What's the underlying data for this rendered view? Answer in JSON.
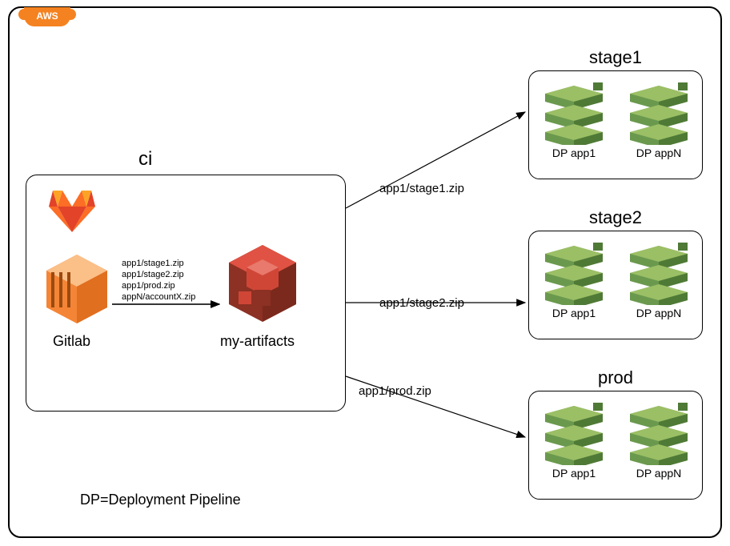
{
  "cloud_badge": "AWS",
  "ci": {
    "title": "ci",
    "source_label": "Gitlab",
    "artifacts_label": "my-artifacts",
    "files": [
      "app1/stage1.zip",
      "app1/stage2.zip",
      "app1/prod.zip",
      "appN/accountX.zip"
    ]
  },
  "arrows": {
    "to_stage1": "app1/stage1.zip",
    "to_stage2": "app1/stage2.zip",
    "to_prod": "app1/prod.zip"
  },
  "environments": [
    {
      "name": "stage1",
      "items": [
        "DP app1",
        "DP appN"
      ]
    },
    {
      "name": "stage2",
      "items": [
        "DP app1",
        "DP appN"
      ]
    },
    {
      "name": "prod",
      "items": [
        "DP app1",
        "DP appN"
      ]
    }
  ],
  "footnote": "DP=Deployment Pipeline"
}
